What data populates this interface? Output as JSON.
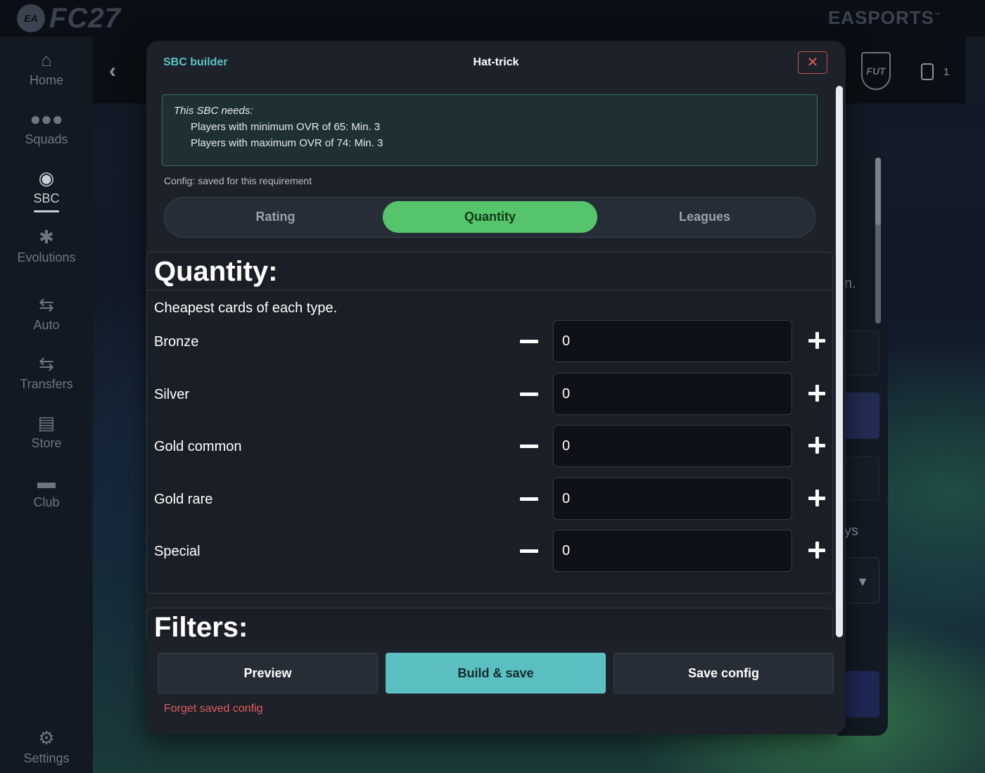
{
  "app": {
    "logo_badge": "EA",
    "logo_title": "FC27",
    "brand": "EASPORTS",
    "coin_count": "1"
  },
  "sidebar": {
    "items": [
      {
        "label": "Home",
        "icon": "home-icon"
      },
      {
        "label": "Squads",
        "icon": "people-icon"
      },
      {
        "label": "SBC",
        "icon": "sbc-icon"
      },
      {
        "label": "Evolutions",
        "icon": "dna-icon"
      },
      {
        "label": "Auto",
        "icon": "swap-icon"
      },
      {
        "label": "Transfers",
        "icon": "swap-icon"
      },
      {
        "label": "Store",
        "icon": "cart-icon"
      },
      {
        "label": "Club",
        "icon": "club-icon"
      },
      {
        "label": "Settings",
        "icon": "gear-icon"
      }
    ],
    "active": "SBC"
  },
  "background_panel": {
    "partial_text_1": "n.",
    "partial_text_2": "ys"
  },
  "modal": {
    "header_left": "SBC builder",
    "title": "Hat-trick",
    "close_label": "✕",
    "needs": {
      "title": "This SBC needs:",
      "lines": [
        "Players with minimum OVR of 65: Min. 3",
        "Players with maximum OVR of 74: Min. 3"
      ]
    },
    "config_note": "Config: saved for this requirement",
    "tabs": [
      {
        "label": "Rating"
      },
      {
        "label": "Quantity"
      },
      {
        "label": "Leagues"
      }
    ],
    "active_tab": "Quantity",
    "quantity": {
      "title": "Quantity:",
      "subtitle": "Cheapest cards of each type.",
      "rows": [
        {
          "label": "Bronze",
          "value": "0"
        },
        {
          "label": "Silver",
          "value": "0"
        },
        {
          "label": "Gold common",
          "value": "0"
        },
        {
          "label": "Gold rare",
          "value": "0"
        },
        {
          "label": "Special",
          "value": "0"
        }
      ]
    },
    "filters": {
      "title": "Filters:"
    },
    "footer": {
      "preview": "Preview",
      "build_save": "Build & save",
      "save_config": "Save config",
      "forget": "Forget saved config"
    }
  },
  "colors": {
    "accent_teal": "#5bc4c4",
    "tab_active_green": "#55c46a",
    "danger_red": "#e35d5b",
    "modal_bg": "#1c212a"
  }
}
